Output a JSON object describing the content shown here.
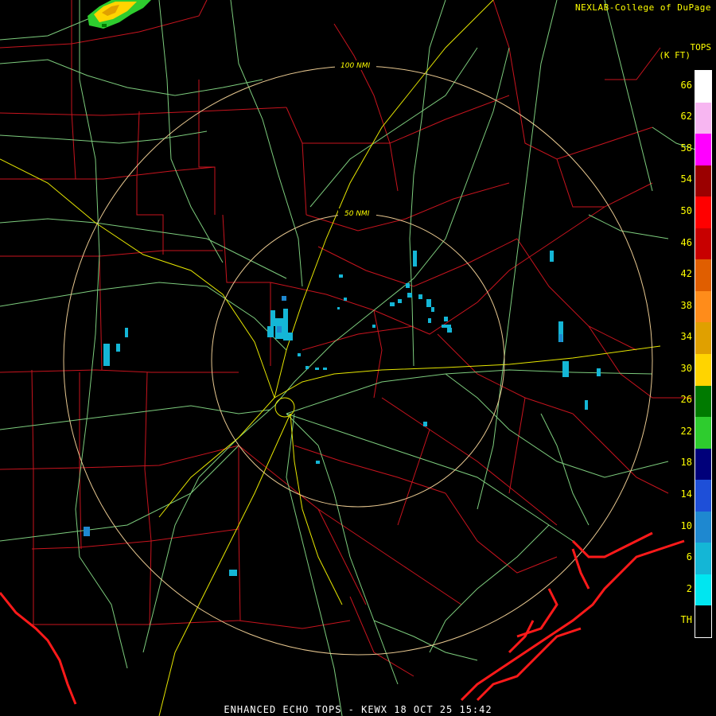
{
  "credit": "NEXLAB-College of DuPage",
  "legend": {
    "title": "TOPS",
    "units": "(K FT)",
    "ticks": [
      "66",
      "62",
      "58",
      "54",
      "50",
      "46",
      "42",
      "38",
      "34",
      "30",
      "26",
      "22",
      "18",
      "14",
      "10",
      "6",
      "2",
      "TH"
    ],
    "colors": [
      "#ffffff",
      "#f7b6f1",
      "#ff00ff",
      "#9b0000",
      "#ff0000",
      "#c80000",
      "#e05e00",
      "#ff8c1a",
      "#e0a000",
      "#ffd400",
      "#007a00",
      "#2ecc2e",
      "#00007a",
      "#1e4fd8",
      "#1e88d0",
      "#14b6d6",
      "#00e6f0",
      "#000000"
    ]
  },
  "rings": [
    {
      "label": "50 NMI",
      "radius_nmi": 50
    },
    {
      "label": "100 NMI",
      "radius_nmi": 100
    }
  ],
  "footer": "ENHANCED ECHO TOPS - KEWX 18 OCT 25 15:42",
  "colors": {
    "county": "#c8141e",
    "highway": "#7dcc7d",
    "interstate": "#e6e600",
    "coast": "#ff1a1a",
    "echo_low": "#14b6d6",
    "echo_mid": "#1e88d0"
  }
}
